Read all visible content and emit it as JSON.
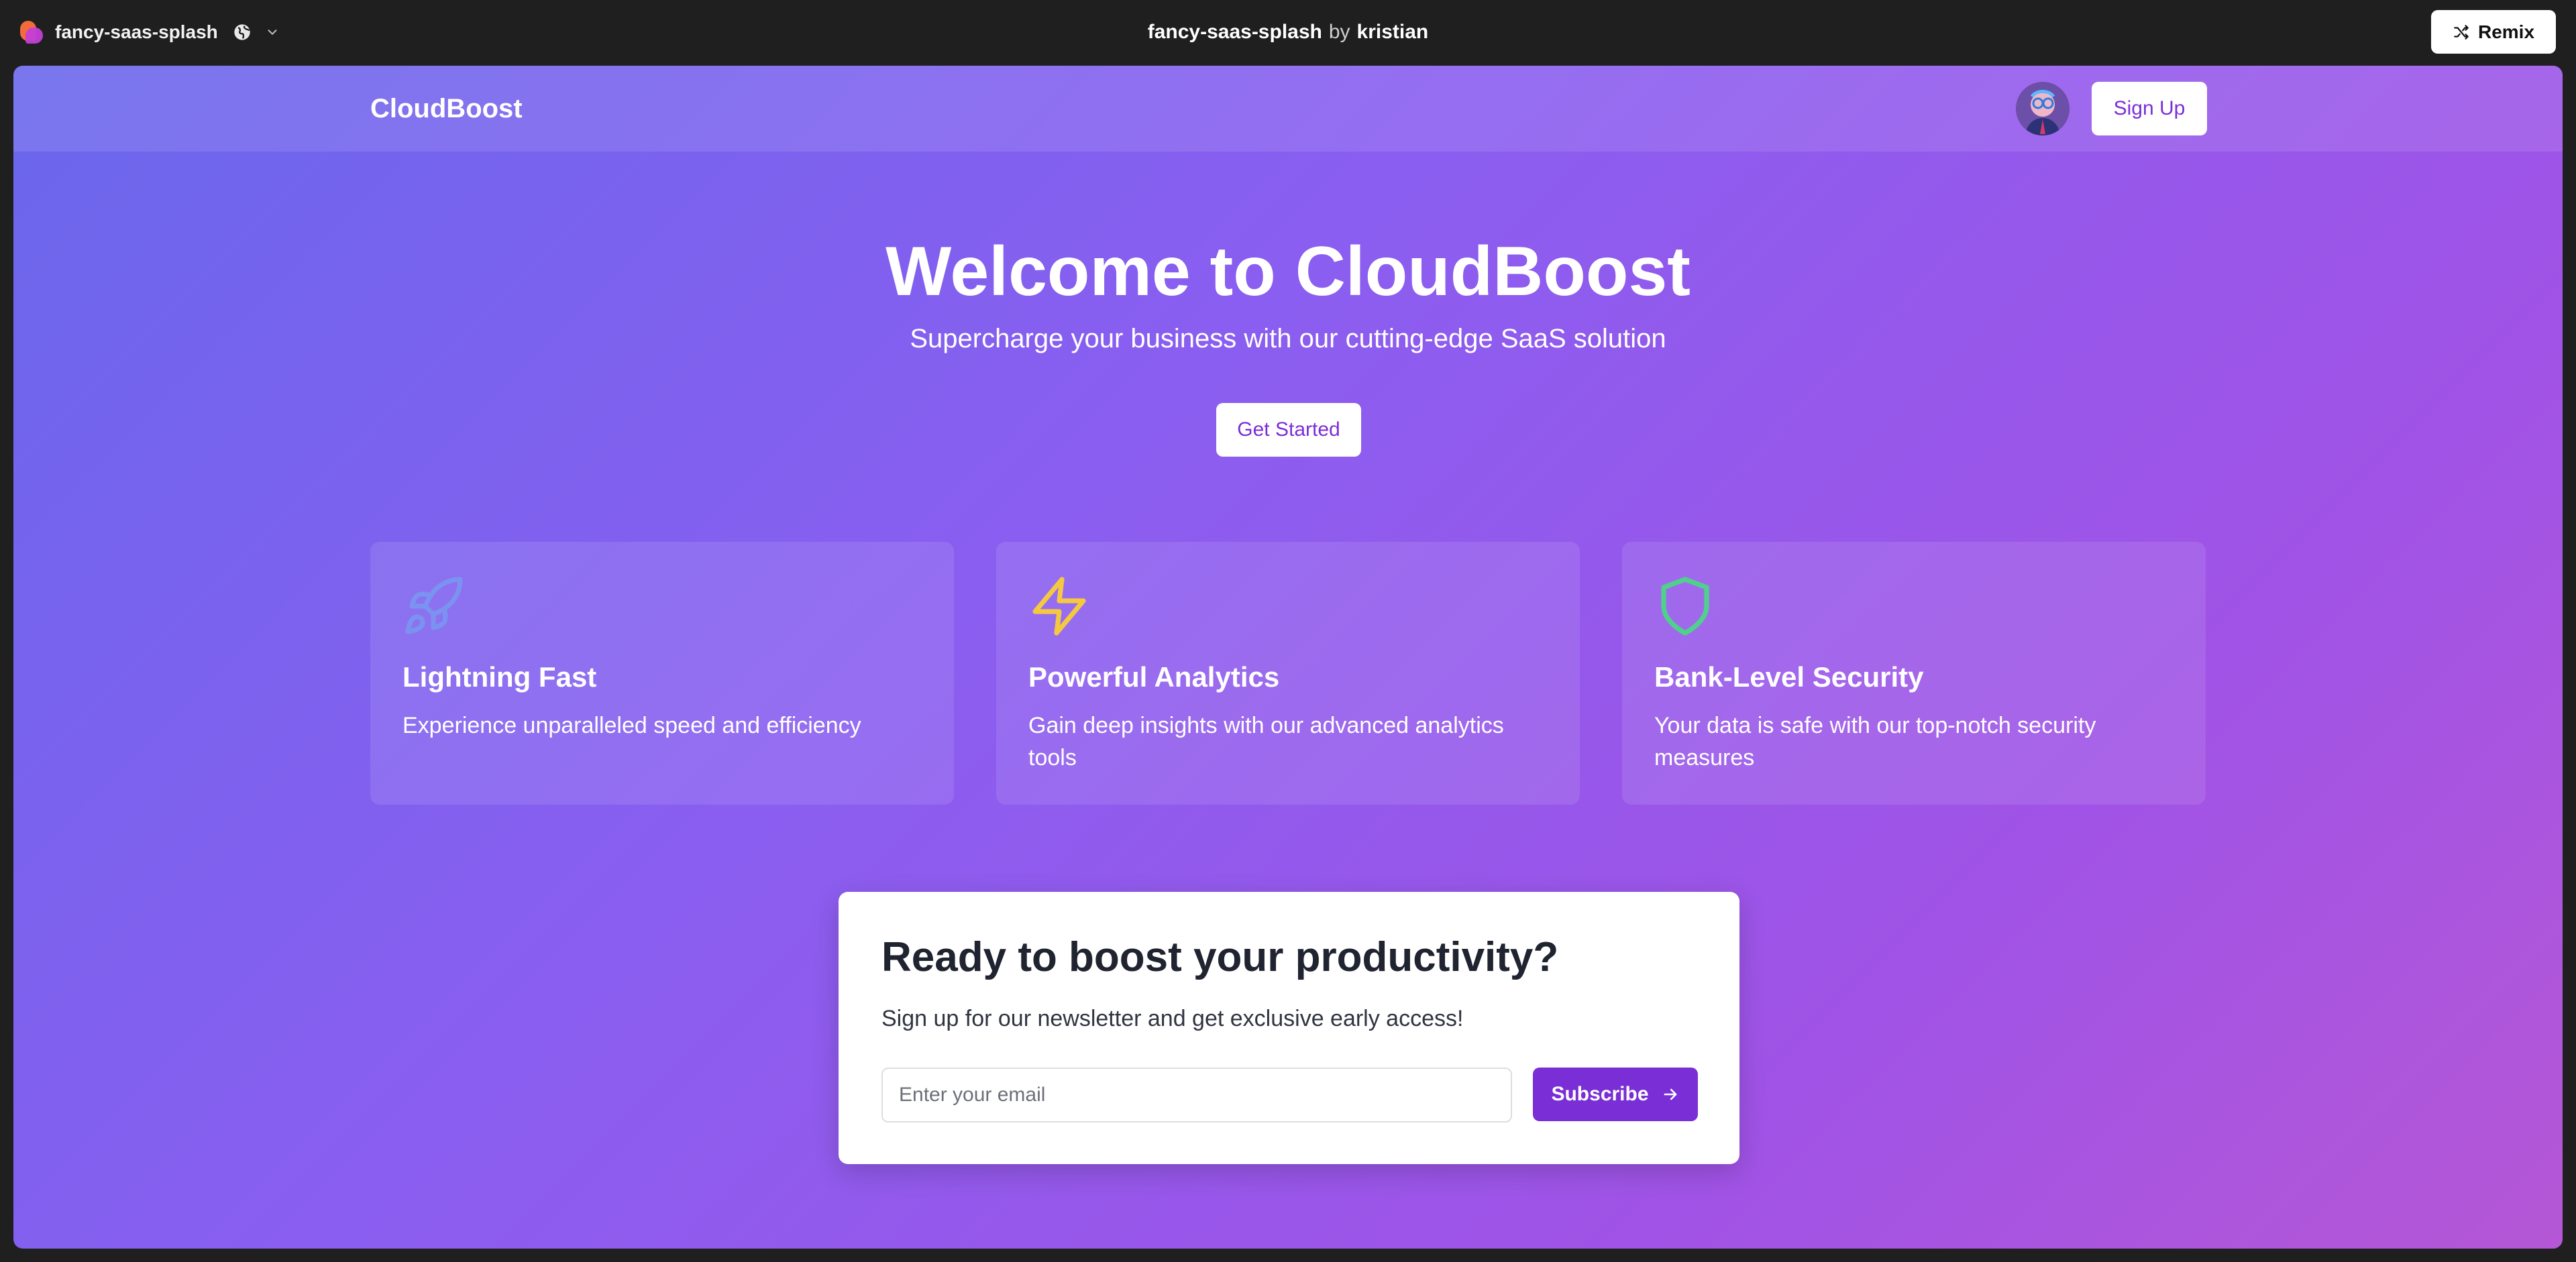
{
  "host": {
    "project_name": "fancy-saas-splash",
    "title_project": "fancy-saas-splash",
    "title_by": "by",
    "title_author": "kristian",
    "remix_label": "Remix"
  },
  "nav": {
    "brand": "CloudBoost",
    "signup_label": "Sign Up"
  },
  "hero": {
    "title": "Welcome to CloudBoost",
    "subtitle": "Supercharge your business with our cutting-edge SaaS solution",
    "cta_label": "Get Started"
  },
  "features": [
    {
      "icon": "rocket-icon",
      "icon_color": "#7c92f0",
      "title": "Lightning Fast",
      "description": "Experience unparalleled speed and efficiency"
    },
    {
      "icon": "lightning-icon",
      "icon_color": "#f5c842",
      "title": "Powerful Analytics",
      "description": "Gain deep insights with our advanced analytics tools"
    },
    {
      "icon": "shield-icon",
      "icon_color": "#4fd18b",
      "title": "Bank-Level Security",
      "description": "Your data is safe with our top-notch security measures"
    }
  ],
  "newsletter": {
    "title": "Ready to boost your productivity?",
    "text": "Sign up for our newsletter and get exclusive early access!",
    "email_placeholder": "Enter your email",
    "email_value": "",
    "subscribe_label": "Subscribe"
  },
  "colors": {
    "accent": "#7a2ed6",
    "gradient_start": "#6a67ec",
    "gradient_end": "#b557d6"
  }
}
